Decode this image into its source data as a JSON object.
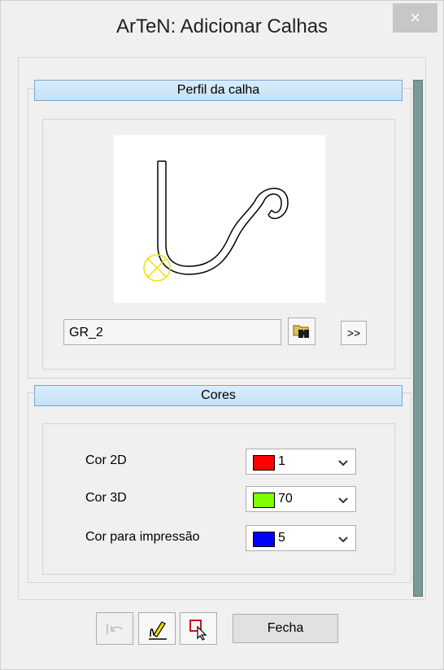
{
  "window": {
    "title": "ArTeN: Adicionar Calhas",
    "close_glyph": "×"
  },
  "profile": {
    "header": "Perfil da calha",
    "name_value": "GR_2",
    "browse_icon": "binoculars-folder-icon",
    "more_label": ">>"
  },
  "colors": {
    "header": "Cores",
    "rows": [
      {
        "label": "Cor 2D",
        "value": "1",
        "swatch": "#ff0000"
      },
      {
        "label": "Cor 3D",
        "value": "70",
        "swatch": "#80ff00"
      },
      {
        "label": "Cor para impressão",
        "value": "5",
        "swatch": "#0000ff"
      }
    ]
  },
  "footer": {
    "undo_icon": "undo-icon",
    "edit_icon": "pencil-edit-icon",
    "select_icon": "select-cursor-icon",
    "close_label": "Fecha"
  }
}
